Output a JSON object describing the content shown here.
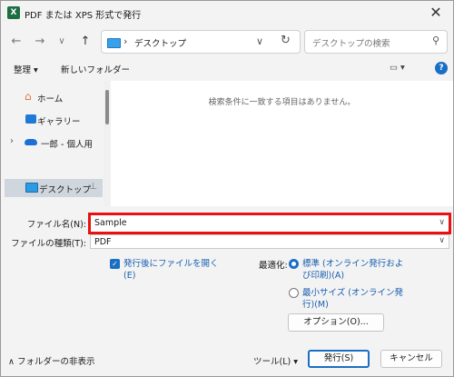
{
  "window": {
    "title": "PDF または XPS 形式で発行",
    "app_icon": "excel-icon",
    "close_label": "✕"
  },
  "nav": {
    "back": "←",
    "forward": "→",
    "recent": "∨",
    "up": "↑",
    "address_sep": "›",
    "address_text": "デスクトップ",
    "address_chevron": "∨",
    "refresh": "↻",
    "search_placeholder": "デスクトップの検索"
  },
  "toolbar": {
    "organize": "整理 ▾",
    "new_folder": "新しいフォルダー",
    "view": "▭ ▾",
    "help": "?"
  },
  "sidebar": {
    "items": [
      {
        "label": "ホーム",
        "icon": "home-icon"
      },
      {
        "label": "ギャラリー",
        "icon": "gallery-icon"
      },
      {
        "label": "一郎 - 個人用",
        "icon": "onedrive-cloud-icon",
        "expander": "›"
      },
      {
        "label": "デスクトップ",
        "icon": "desktop-folder-icon",
        "pin": "📌"
      }
    ]
  },
  "files": {
    "empty_message": "検索条件に一致する項目はありません。"
  },
  "form": {
    "filename_label": "ファイル名(N):",
    "filename_value": "Sample",
    "filetype_label": "ファイルの種類(T):",
    "filetype_value": "PDF",
    "open_after_line1": "発行後にファイルを開く",
    "open_after_line2": "(E)",
    "optimize_label": "最適化:",
    "standard_line1": "標準 (オンライン発行およ",
    "standard_line2": "び印刷)(A)",
    "minimum_line1": "最小サイズ (オンライン発",
    "minimum_line2": "行)(M)",
    "options_button": "オプション(O)..."
  },
  "footer": {
    "hide_folders": "フォルダーの非表示",
    "tools": "ツール(L)",
    "publish": "発行(S)",
    "cancel": "キャンセル"
  },
  "colors": {
    "accent": "#1a6fc5",
    "highlight_border": "#e81010",
    "excel_green": "#1d6f42"
  }
}
